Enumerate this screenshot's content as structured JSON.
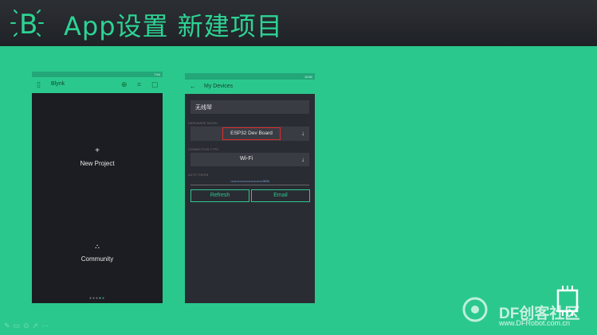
{
  "header": {
    "logo_letter": "B",
    "title": "App设置 新建项目"
  },
  "phone1": {
    "status_time": "7:54",
    "toolbar_title": "Blynk",
    "new_project": {
      "icon": "+",
      "label": "New Project"
    },
    "community": {
      "label": "Community"
    },
    "pager_dots": "●●●●●"
  },
  "phone2": {
    "status_time": "10:51",
    "toolbar_title": "My Devices",
    "device_name": "无线琴",
    "hardware_label": "HARDWARE MODEL",
    "hardware_value": "ESP32 Dev Board",
    "connection_label": "CONNECTION TYPE",
    "connection_value": "Wi-Fi",
    "token_label": "AUTH TOKEN",
    "token_value": "•••••••••••••••••••••••••••••9f08",
    "refresh_label": "Refresh",
    "email_label": "Email"
  },
  "watermark": {
    "title": "DF创客社区",
    "url": "www.DFRobot.com.cn"
  },
  "colors": {
    "background": "#2bc88d",
    "header": "#25282d",
    "accent": "#2dd394",
    "highlight": "#e02b2b"
  }
}
